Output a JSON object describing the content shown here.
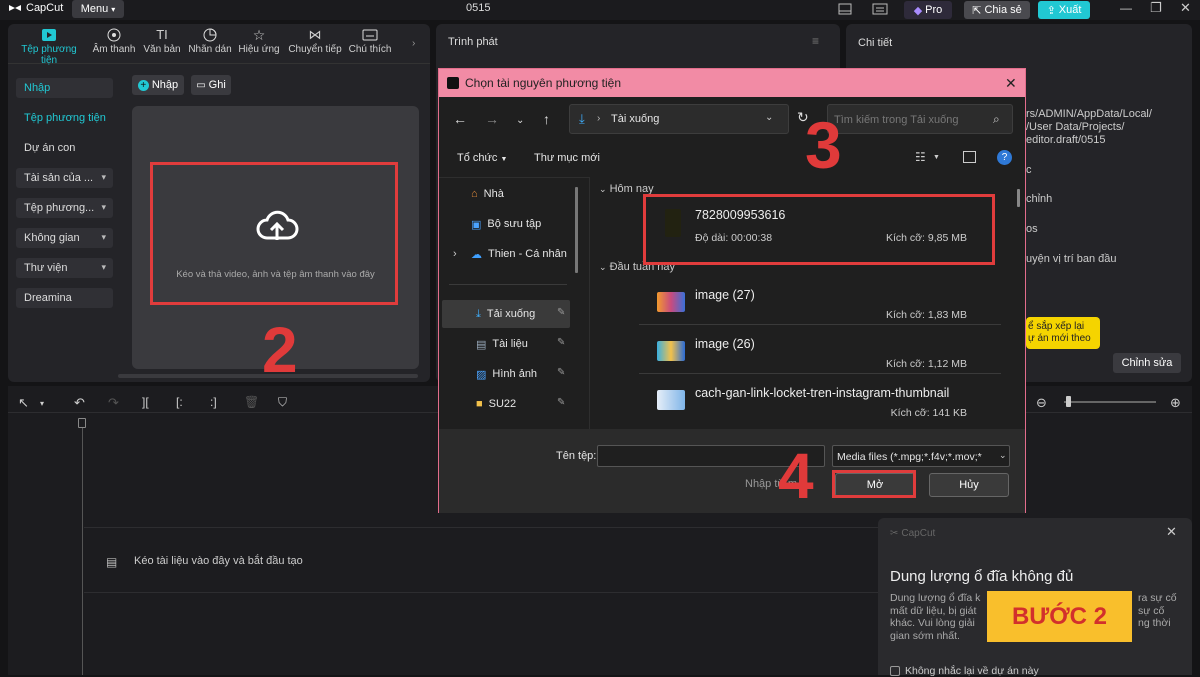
{
  "app": {
    "name": "CapCut",
    "menu_label": "Menu",
    "project_name": "0515",
    "pro_label": "Pro",
    "share_label": "Chia sẻ",
    "export_label": "Xuất"
  },
  "toolbar": {
    "items": [
      {
        "label": "Tệp phương tiện",
        "icon": "media-icon"
      },
      {
        "label": "Âm thanh",
        "icon": "audio-icon"
      },
      {
        "label": "Văn bản",
        "icon": "text-icon"
      },
      {
        "label": "Nhãn dán",
        "icon": "sticker-icon"
      },
      {
        "label": "Hiệu ứng",
        "icon": "effects-icon"
      },
      {
        "label": "Chuyển tiếp",
        "icon": "transition-icon"
      },
      {
        "label": "Chú thích",
        "icon": "caption-icon"
      }
    ]
  },
  "sidebar": {
    "items": [
      "Nhập",
      "Tệp phương tiện",
      "Dự án con",
      "Tài sản của ...",
      "Tệp phương...",
      "Không gian",
      "Thư viện",
      "Dreamina"
    ]
  },
  "media": {
    "import_label": "Nhập",
    "record_label": "Ghi",
    "drop_text": "Kéo và thả video, ảnh và tệp âm thanh vào đây"
  },
  "player": {
    "title": "Trình phát"
  },
  "details": {
    "title": "Chi tiết",
    "path_lines": [
      "rs/ADMIN/AppData/Local/",
      "/User Data/Projects/",
      "editor.draft/0515"
    ],
    "text_frags": [
      "c",
      "chỉnh",
      "os",
      "uyện vị trí ban đầu"
    ],
    "edit_label": "Chỉnh sửa",
    "tooltip_lines": [
      "ể sắp xếp lại",
      "ự án mới theo"
    ]
  },
  "timeline": {
    "drop_text": "Kéo tài liệu vào đây và bắt đầu tạo"
  },
  "dialog": {
    "title": "Chọn tài nguyên phương tiện",
    "address": "Tài xuống",
    "search_placeholder": "Tìm kiếm trong Tải xuống",
    "organize_label": "Tổ chức",
    "new_folder_label": "Thư mục mới",
    "tree": [
      "Nhà",
      "Bộ sưu tập",
      "Thien - Cá nhân",
      "Tải xuống",
      "Tài liệu",
      "Hình ảnh",
      "SU22"
    ],
    "groups": [
      "Hôm nay",
      "Đầu tuần này"
    ],
    "files": [
      {
        "name": "7828009953616",
        "duration": "Độ dài: 00:00:38",
        "size": "Kích cỡ: 9,85 MB"
      },
      {
        "name": "image (27)",
        "size": "Kích cỡ: 1,83 MB"
      },
      {
        "name": "image (26)",
        "size": "Kích cỡ: 1,12 MB"
      },
      {
        "name": "cach-gan-link-locket-tren-instagram-thumbnail",
        "size": "Kích cỡ: 141 KB"
      }
    ],
    "filename_label": "Tên tệp:",
    "filter_value": "Media files (*.mpg;*.f4v;*.mov;*",
    "import_from_label": "Nhập từ m",
    "open_label": "Mở",
    "cancel_label": "Hủy"
  },
  "toast": {
    "brand": "CapCut",
    "title": "Dung lượng ổ đĩa không đủ",
    "lines": [
      "Dung lượng ổ đĩa k",
      "mất dữ liệu, bị giát",
      "khác. Vui lòng giải",
      "gian sớm nhất."
    ],
    "right_frags": [
      "ra sự cố",
      "sự cố",
      "ng thời"
    ],
    "checkbox_label": "Không nhắc lại về dự án này"
  },
  "annotations": {
    "step2": "2",
    "step3": "3",
    "step4": "4",
    "banner": "BƯỚC 2"
  },
  "colors": {
    "accent": "#21c8d3",
    "annotation_red": "#e03a3a",
    "dialog_title_bg": "#f28ba5",
    "banner_bg": "#f9bf2c"
  }
}
